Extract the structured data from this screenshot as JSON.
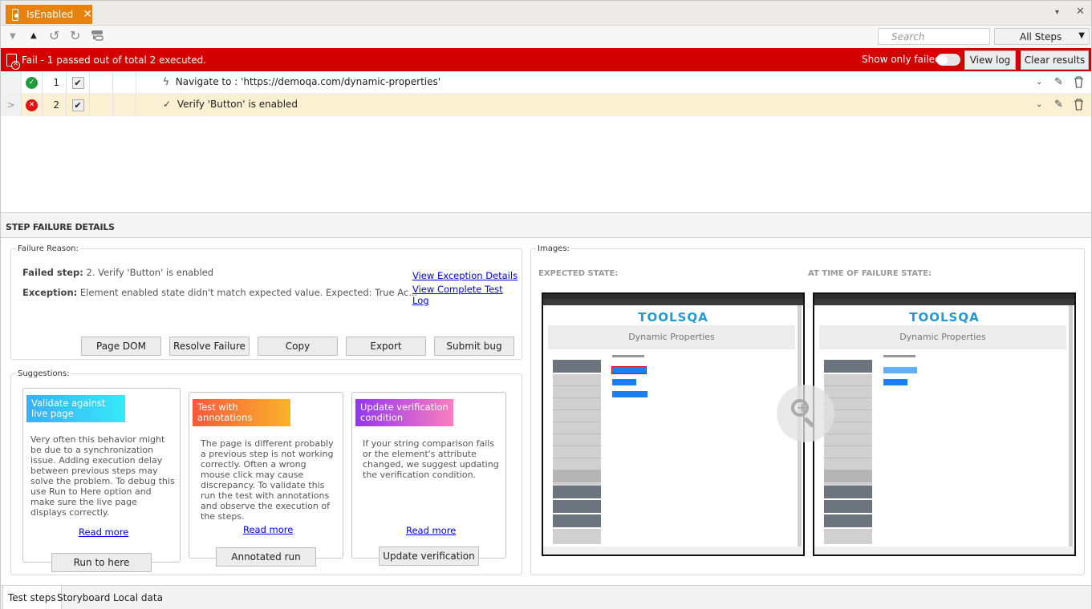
{
  "tab": {
    "title": "IsEnabled",
    "icon": "test-file-icon"
  },
  "window_controls": {
    "menu_glyph": "▾",
    "close_glyph": "✕"
  },
  "toolbar": {
    "icons": [
      "move-down-icon",
      "move-up-icon",
      "undo-icon",
      "redo-icon",
      "recorder-icon"
    ],
    "search_placeholder": "Search",
    "filter_selected": "All Steps"
  },
  "status": {
    "text": "Fail - 1 passed out of total 2 executed.",
    "show_only_failed_label": "Show only failed",
    "show_only_failed": false,
    "view_log_label": "View log",
    "clear_results_label": "Clear results",
    "color": "#d40000"
  },
  "steps": [
    {
      "num": "1",
      "status": "passed",
      "checked": true,
      "icon": "lightning-icon",
      "glyph": "ϟ",
      "description": "Navigate to : 'https://demoqa.com/dynamic-properties'"
    },
    {
      "num": "2",
      "status": "failed",
      "checked": true,
      "icon": "checkmark-icon",
      "glyph": "✓",
      "description": "Verify 'Button' is enabled",
      "expand_glyph": ">"
    }
  ],
  "failure": {
    "section_title": "STEP FAILURE DETAILS",
    "reason_legend": "Failure Reason:",
    "failed_step_label": "Failed step:",
    "failed_step_value": "2. Verify 'Button' is enabled",
    "exception_label": "Exception:",
    "exception_value": "Element enabled state didn't match expected value. Expected: True Ac...",
    "links": {
      "exception_details": "View Exception Details",
      "complete_log": "View Complete Test Log"
    },
    "buttons": [
      "Page DOM",
      "Resolve Failure",
      "Copy",
      "Export",
      "Submit bug"
    ]
  },
  "suggestions": {
    "legend": "Suggestions:",
    "cards": [
      {
        "title": "Validate against live page",
        "body": "Very often this behavior might be due to a synchronization issue. Adding execution delay between previous steps may solve the problem. To debug this use Run to Here option and make sure the live page displays correctly.",
        "link": "Read more",
        "button": "Run to here",
        "gradient": [
          "#3aaef7",
          "#36eaf8"
        ]
      },
      {
        "title": "Test with annotations",
        "body": "The page is different probably a previous step is not working correctly. Often a wrong mouse click may cause discrepancy. To validate this run the test with annotations and observe the execution of the steps.",
        "link": "Read more",
        "button": "Annotated run",
        "gradient": [
          "#f8583c",
          "#f9b42a"
        ]
      },
      {
        "title": "Update verification condition",
        "body": "If your string comparison fails or the element's attribute changed, we suggest updating the verification condition.",
        "link": "Read more",
        "button": "Update verification",
        "gradient": [
          "#9236f0",
          "#fb7ebf"
        ]
      }
    ]
  },
  "images": {
    "legend": "Images:",
    "expected_label": "EXPECTED STATE:",
    "failure_label": "AT TIME OF FAILURE STATE:",
    "logo_text": "TOOLSQA",
    "page_heading": "Dynamic Properties"
  },
  "bottom_tabs": [
    {
      "label": "Test steps",
      "active": true
    },
    {
      "label": "Storyboard",
      "active": false
    },
    {
      "label": "Local data",
      "active": false
    }
  ]
}
